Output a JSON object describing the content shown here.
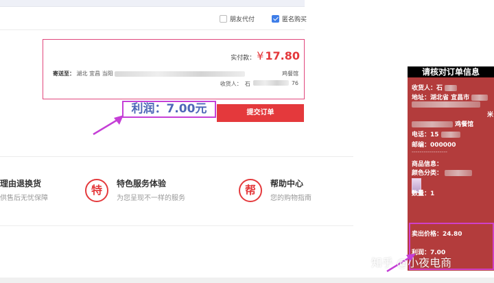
{
  "options": {
    "friend_pay": "朋友代付",
    "anonymous_buy": "匿名购买",
    "anonymous_checked": true
  },
  "order": {
    "pay_label": "实付款：",
    "currency": "¥",
    "amount": "17.80",
    "ship_label": "寄送至：",
    "ship_region": "湖北 宜昌 当阳",
    "ship_tail": "鸡餐馆",
    "receiver_label": "收货人：",
    "receiver_name": "石",
    "receiver_tail": "76"
  },
  "profit_tag": "利润：7.00元",
  "submit_button": "提交订单",
  "services": [
    {
      "icon": "",
      "title": "理由退换货",
      "subtitle": "供售后无忧保障"
    },
    {
      "icon": "特",
      "title": "特色服务体验",
      "subtitle": "为您呈现不一样的服务"
    },
    {
      "icon": "帮",
      "title": "帮助中心",
      "subtitle": "您的购物指南"
    }
  ],
  "panel": {
    "title": "请核对订单信息",
    "receiver": "收货人：石",
    "address": "地址：湖北省 宜昌市",
    "address_end1": "米",
    "address_end2": "鸡餐馆",
    "phone": "电话：15",
    "postcode": "邮编：000000",
    "divider": "------------------",
    "product_info": "商品信息：",
    "color_category": "颜色分类：",
    "quantity": "数量：1",
    "sale_price": "卖出价格：24.80",
    "profit": "利润：7.00"
  },
  "watermark": "知乎 @小夜电商",
  "colors": {
    "accent_red": "#e4393c",
    "panel_bg": "#b33c3c",
    "annotation_magenta": "#c53fd6",
    "profit_text": "#4f67b8"
  }
}
